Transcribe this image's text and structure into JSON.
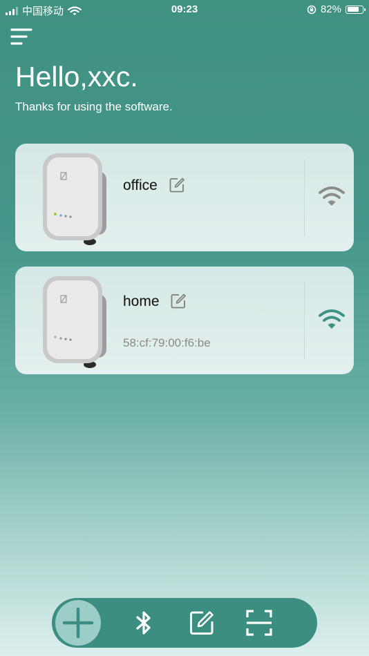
{
  "status_bar": {
    "carrier": "中国移动",
    "time": "09:23",
    "battery_text": "82%",
    "battery_level": 0.82
  },
  "header": {
    "menu_icon": "menu-icon",
    "greeting": "Hello,xxc.",
    "subtitle": "Thanks for using the software."
  },
  "devices": [
    {
      "name": "office",
      "mac": "",
      "wifi_status": "offline",
      "wifi_color": "#8c8c8c"
    },
    {
      "name": "home",
      "mac": "58:cf:79:00:f6:be",
      "wifi_status": "online",
      "wifi_color": "#3e9180"
    }
  ],
  "toolbar": {
    "items": [
      "plus-icon",
      "bluetooth-icon",
      "edit-icon",
      "scan-icon"
    ]
  },
  "colors": {
    "accent": "#3f9180",
    "card_bg": "#dcecea",
    "text_muted": "#8a8a8a"
  }
}
